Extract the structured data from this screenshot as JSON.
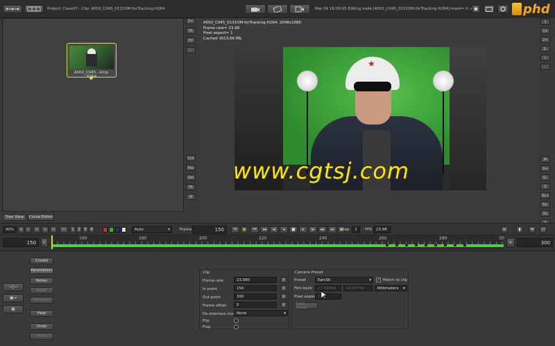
{
  "topbar": {
    "project_label": "Project: Class07 - Clip: A002_C045_0131OM-forTracking-H264",
    "status_text": "Mar 04 16:59:05 Editing node [A002_C045_0131OM-forTracking-H264] mask= 0, enhanc",
    "logo_text": "phd"
  },
  "node": {
    "label": "A002_C045...king-H264"
  },
  "node_panel_buttons": [
    "P+",
    "P1",
    "P2",
    "P-"
  ],
  "node_side_buttons": [
    "Cut",
    "Pas",
    "Del",
    "Fit",
    "M"
  ],
  "tabs": [
    "Tree View",
    "Curve Editor"
  ],
  "viewer_info": [
    "A002_C045_0131OM-forTracking-H264: 2048x1080",
    "Frame rate= 23.98",
    "Pixel aspect= 1",
    "Cached 1613.66 Mb"
  ],
  "watermark": "www.cgtsj.com",
  "right_buttons_top": [
    "1",
    "1+",
    "2+",
    "2-",
    "+",
    "-"
  ],
  "right_buttons_bottom": [
    "M",
    "G+",
    "G-",
    "G",
    "GL+",
    "GL-",
    "GL",
    "S"
  ],
  "transport": {
    "zoom": "40%",
    "channels": [
      "1",
      "2",
      "3",
      "4"
    ],
    "mode_select": "Auto",
    "frame_label": "Frame",
    "frame_value": "150",
    "step_label": "Step",
    "step_value": "1",
    "fps_label": "FPS",
    "fps_value": "23.98"
  },
  "timeline": {
    "start": "150",
    "end": "300",
    "ticks": [
      "160",
      "180",
      "200",
      "220",
      "240",
      "260",
      "280",
      "30"
    ]
  },
  "left_buttons": [
    "Create",
    "Parameters",
    "Notes",
    "Mask",
    "Enhance",
    "Help",
    "Undo",
    "Redo"
  ],
  "clip_panel": {
    "title": "Clip",
    "rows": [
      {
        "label": "Frame rate",
        "value": "23.980"
      },
      {
        "label": "In point",
        "value": "150"
      },
      {
        "label": "Out point",
        "value": "300"
      },
      {
        "label": "Frame offset",
        "value": "0"
      }
    ],
    "deinterlace_label": "De-interlace mode",
    "deinterlace_value": "None",
    "flip_label": "Flip",
    "flop_label": "Flop",
    "reset_label": "R"
  },
  "camera_panel": {
    "title": "Camera Preset",
    "preset_label": "Preset",
    "preset_value": "EpicSK",
    "match_label": "Match to clip",
    "filmback_label": "Film back",
    "filmback_w": "27.59994",
    "filmback_h": "14.60740",
    "units_value": "Millimeters",
    "pixel_aspect_label": "Pixel aspect",
    "pixel_aspect_value": "1.0",
    "save_label": "Save Preset"
  },
  "colors": {
    "accent": "#c8e040",
    "timeline_green": "#4cd42a",
    "chroma": "#3fa53a"
  }
}
